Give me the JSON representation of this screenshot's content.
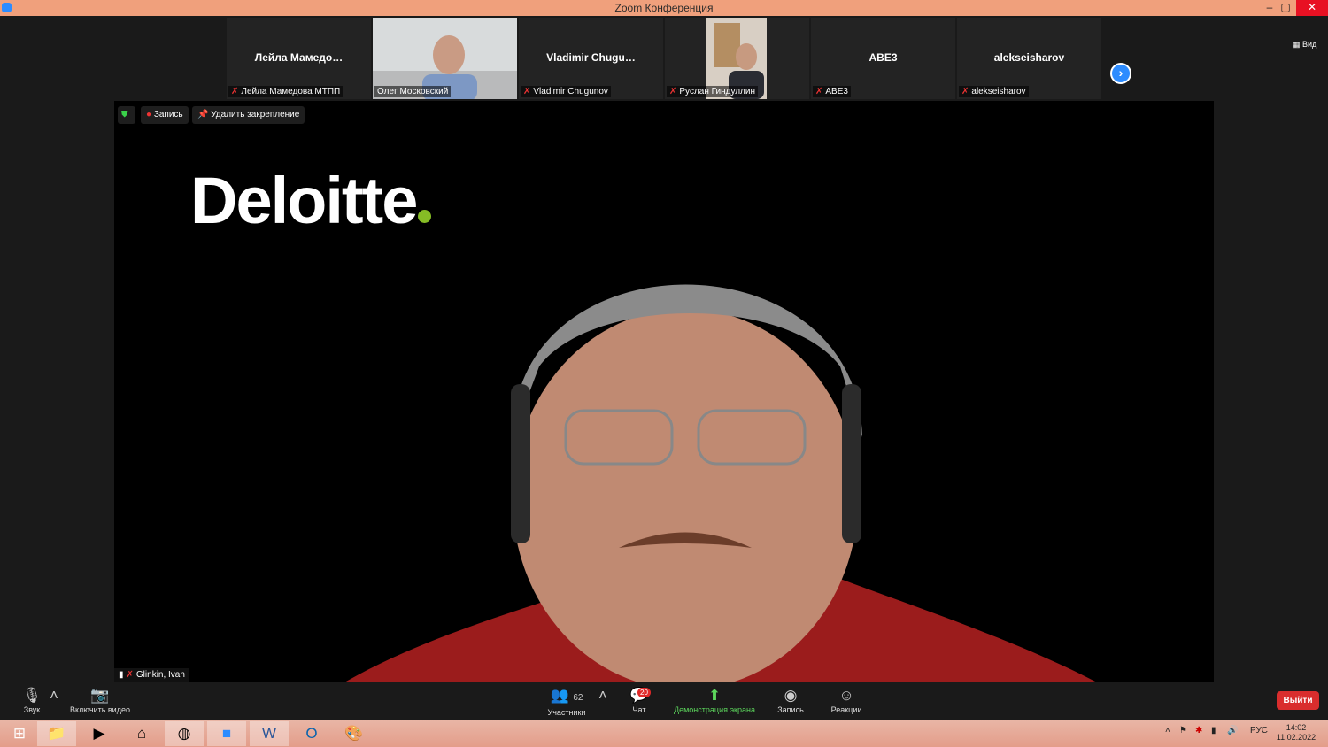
{
  "window": {
    "title": "Zoom Конференция",
    "minimize": "–",
    "maximize": "▢",
    "close": "✕"
  },
  "participants_strip": {
    "tiles": [
      {
        "display_name": "Лейла  Мамедо…",
        "label": "Лейла Мамедова МТПП",
        "video": false
      },
      {
        "display_name": "",
        "label": "Олег Московский",
        "video": true
      },
      {
        "display_name": "Vladimir  Chugu…",
        "label": "Vladimir Chugunov",
        "video": false
      },
      {
        "display_name": "",
        "label": "Руслан Гиндуллин",
        "video": true
      },
      {
        "display_name": "ABE3",
        "label": "ABE3",
        "video": false
      },
      {
        "display_name": "alekseisharov",
        "label": "alekseisharov",
        "video": false
      }
    ],
    "next_icon": "chevron-right-icon",
    "view_label": "Вид"
  },
  "main_video": {
    "recording_label": "Запись",
    "unpin_label": "Удалить закрепление",
    "logo_text": "Deloitte",
    "speaker_name": "Glinkin, Ivan"
  },
  "toolbar": {
    "audio_label": "Звук",
    "video_label": "Включить видео",
    "participants_label": "Участники",
    "participants_count": "62",
    "chat_label": "Чат",
    "chat_badge": "20",
    "share_label": "Демонстрация экрана",
    "record_label": "Запись",
    "reactions_label": "Реакции",
    "leave_label": "Выйти"
  },
  "taskbar": {
    "language": "РУС",
    "time": "14:02",
    "date": "11.02.2022"
  },
  "colors": {
    "titlebar": "#f0a07c",
    "accent": "#2d8cff",
    "share_green": "#5cd65c",
    "leave_red": "#d92d2d",
    "deloitte_dot": "#86bc25"
  }
}
